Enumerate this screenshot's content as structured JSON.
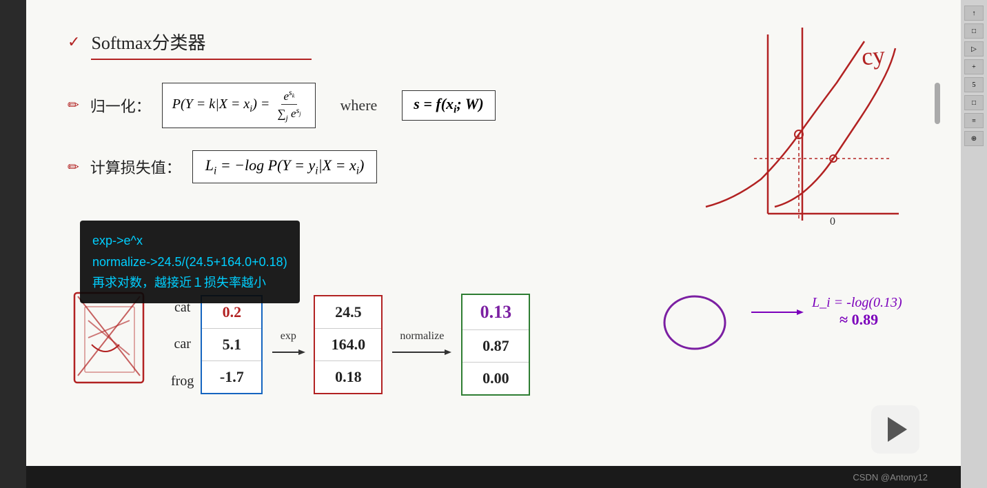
{
  "title": {
    "icon": "✓",
    "text": "Softmax分类器"
  },
  "normalize_section": {
    "icon": "✏",
    "label": "归一化：",
    "formula_main": "P(Y = k|X = x_i) = e^{s_k} / Σ_j e^{s_j}",
    "where": "where",
    "formula_s": "s = f(x_i; W)"
  },
  "loss_section": {
    "icon": "✏",
    "label": "计算损失值：",
    "formula": "L_i = -log P(Y = y_i | X = x_i)"
  },
  "annotation": {
    "line1": "exp->e^x",
    "line2": "normalize->24.5/(24.5+164.0+0.18)",
    "line3": "再求对数，越接近１损失率越小"
  },
  "table": {
    "arrow1_label": "exp",
    "arrow2_label": "normalize",
    "rows": [
      {
        "label": "cat",
        "score": "0.2",
        "exp": "24.5",
        "norm": "0.13"
      },
      {
        "label": "car",
        "score": "5.1",
        "exp": "164.0",
        "norm": "0.87"
      },
      {
        "label": "frog",
        "score": "-1.7",
        "exp": "0.18",
        "norm": "0.00"
      }
    ]
  },
  "loss_result": {
    "formula": "L_i = -log(0.13)",
    "value": "≈ 0.89"
  },
  "watermark": "CSDN @Antony12",
  "sidebar": {
    "buttons": [
      "↑",
      "□",
      "▷",
      "+",
      "5",
      "□",
      "≡",
      "⊕"
    ]
  }
}
